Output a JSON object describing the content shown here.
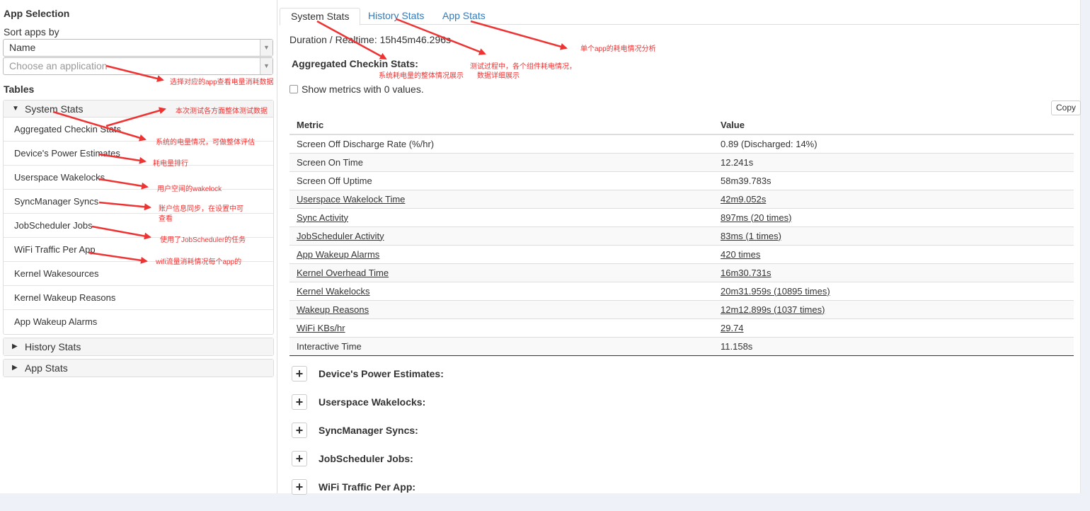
{
  "sidebar": {
    "title": "App Selection",
    "sort_label": "Sort apps by",
    "sort_value": "Name",
    "app_placeholder": "Choose an application",
    "tables_label": "Tables",
    "system_panel": {
      "label": "System Stats",
      "items": [
        "Aggregated Checkin Stats",
        "Device's Power Estimates",
        "Userspace Wakelocks",
        "SyncManager Syncs",
        "JobScheduler Jobs",
        "WiFi Traffic Per App",
        "Kernel Wakesources",
        "Kernel Wakeup Reasons",
        "App Wakeup Alarms"
      ]
    },
    "history_panel": {
      "label": "History Stats"
    },
    "app_panel": {
      "label": "App Stats"
    }
  },
  "tabs": [
    "System Stats",
    "History Stats",
    "App Stats"
  ],
  "main": {
    "duration": "Duration / Realtime: 15h45m46.296s",
    "agg_title": "Aggregated Checkin Stats:",
    "show_metrics": "Show metrics with 0 values.",
    "copy_label": "Copy",
    "table": {
      "headers": [
        "Metric",
        "Value"
      ],
      "rows": [
        {
          "metric": "Screen Off Discharge Rate (%/hr)",
          "value": "0.89 (Discharged: 14%)",
          "link": false
        },
        {
          "metric": "Screen On Time",
          "value": "12.241s",
          "link": false
        },
        {
          "metric": "Screen Off Uptime",
          "value": "58m39.783s",
          "link": false
        },
        {
          "metric": "Userspace Wakelock Time",
          "value": "42m9.052s",
          "link": true
        },
        {
          "metric": "Sync Activity",
          "value": "897ms (20 times)",
          "link": true
        },
        {
          "metric": "JobScheduler Activity",
          "value": "83ms (1 times)",
          "link": true
        },
        {
          "metric": "App Wakeup Alarms",
          "value": "420 times",
          "link": true
        },
        {
          "metric": "Kernel Overhead Time",
          "value": "16m30.731s",
          "link": true
        },
        {
          "metric": "Kernel Wakelocks",
          "value": "20m31.959s (10895 times)",
          "link": true
        },
        {
          "metric": "Wakeup Reasons",
          "value": "12m12.899s (1037 times)",
          "link": true
        },
        {
          "metric": "WiFi KBs/hr",
          "value": "29.74",
          "link": true
        },
        {
          "metric": "Interactive Time",
          "value": "11.158s",
          "link": false
        }
      ]
    },
    "sections": [
      "Device's Power Estimates:",
      "Userspace Wakelocks:",
      "SyncManager Syncs:",
      "JobScheduler Jobs:",
      "WiFi Traffic Per App:"
    ]
  },
  "annotations": {
    "choose_app": "选择对应的app查看电量消耗数据",
    "system_stats": "本次测试各方面整体测试数据",
    "aggregated": "系统的电量情况，可做整体评估",
    "power_estimates": "耗电量排行",
    "wakelocks": "用户空间的wakelock",
    "sync_line1": "账户信息同步，在设置中可",
    "sync_line2": "查看",
    "jobscheduler": "使用了JobScheduler的任务",
    "wifi": "wifi流量消耗情况每个app的",
    "tab_system": "系统耗电量的整体情况展示",
    "tab_history_line1": "测试过程中，各个组件耗电情况，",
    "tab_history_line2": "数据详细展示",
    "tab_app": "单个app的耗电情况分析"
  },
  "colors": {
    "annotation": "#e33333",
    "link": "#337ab7"
  }
}
